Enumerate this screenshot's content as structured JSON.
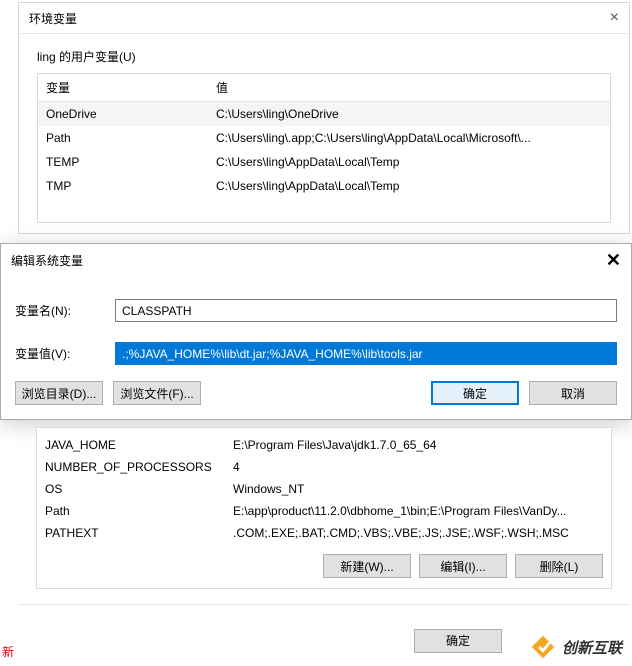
{
  "dialog1": {
    "title": "环境变量",
    "user_section_label": "ling 的用户变量(U)",
    "columns": {
      "var": "变量",
      "val": "值"
    },
    "user_vars": [
      {
        "name": "OneDrive",
        "value": "C:\\Users\\ling\\OneDrive"
      },
      {
        "name": "Path",
        "value": "C:\\Users\\ling\\.app;C:\\Users\\ling\\AppData\\Local\\Microsoft\\..."
      },
      {
        "name": "TEMP",
        "value": "C:\\Users\\ling\\AppData\\Local\\Temp"
      },
      {
        "name": "TMP",
        "value": "C:\\Users\\ling\\AppData\\Local\\Temp"
      }
    ]
  },
  "dialog2": {
    "title": "编辑系统变量",
    "name_label": "变量名(N):",
    "name_value": "CLASSPATH",
    "value_label": "变量值(V):",
    "value_value": ".;%JAVA_HOME%\\lib\\dt.jar;%JAVA_HOME%\\lib\\tools.jar",
    "browse_dir": "浏览目录(D)...",
    "browse_file": "浏览文件(F)...",
    "ok": "确定",
    "cancel": "取消"
  },
  "system_vars": [
    {
      "name": "JAVA_HOME",
      "value": "E:\\Program Files\\Java\\jdk1.7.0_65_64"
    },
    {
      "name": "NUMBER_OF_PROCESSORS",
      "value": "4"
    },
    {
      "name": "OS",
      "value": "Windows_NT"
    },
    {
      "name": "Path",
      "value": "E:\\app\\product\\11.2.0\\dbhome_1\\bin;E:\\Program Files\\VanDy..."
    },
    {
      "name": "PATHEXT",
      "value": ".COM;.EXE;.BAT;.CMD;.VBS;.VBE;.JS;.JSE;.WSF;.WSH;.MSC"
    }
  ],
  "sys_buttons": {
    "new": "新建(W)...",
    "edit": "编辑(I)...",
    "delete": "删除(L)"
  },
  "bottom": {
    "ok": "确定"
  },
  "watermark": {
    "text": "创新互联"
  },
  "red_mark": "新"
}
